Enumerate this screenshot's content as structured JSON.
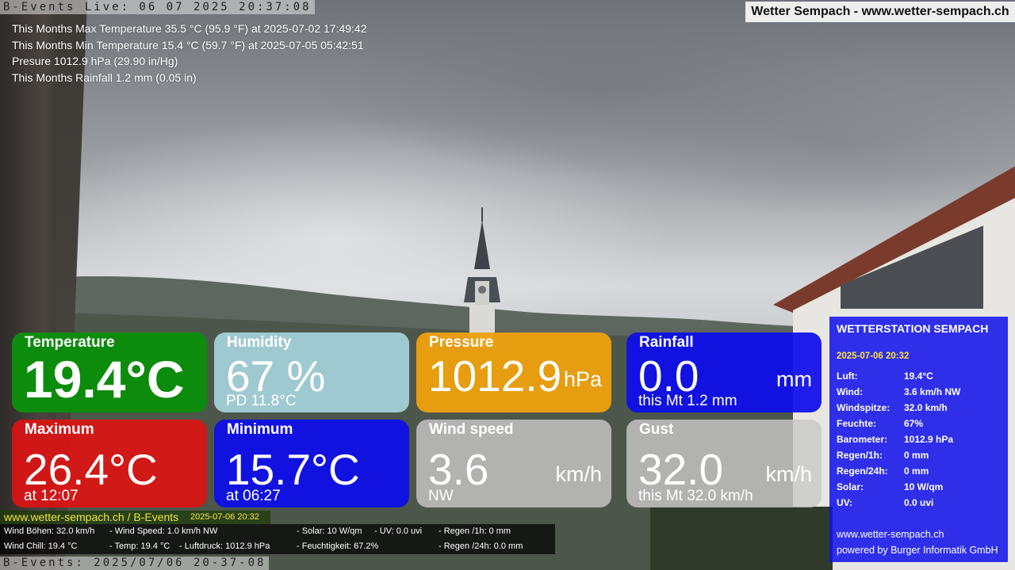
{
  "top_ticker": "B-Events Live: 06 07 2025 20:37:08",
  "site_badge": "Wetter Sempach - www.wetter-sempach.ch",
  "stats": [
    "This Months Max Temperature 35.5 °C (95.9 °F) at 2025-07-02 17:49:42",
    "This Months Min Temperature 15.4 °C (59.7 °F) at 2025-07-05 05:42:51",
    "Presure 1012.9 hPa (29.90 in/Hg)",
    "This Months Rainfall 1.2 mm (0.05 in)"
  ],
  "tiles": {
    "temperature": {
      "label": "Temperature",
      "value": "19.4°C"
    },
    "humidity": {
      "label": "Humidity",
      "value": "67 %",
      "sub": "PD 11.8°C"
    },
    "pressure": {
      "label": "Pressure",
      "value": "1012.9",
      "unit": "hPa"
    },
    "rainfall": {
      "label": "Rainfall",
      "value": "0.0",
      "unit": "mm",
      "sub": "this Mt 1.2 mm"
    },
    "maximum": {
      "label": "Maximum",
      "value": "26.4°C",
      "sub": "at 12:07"
    },
    "minimum": {
      "label": "Minimum",
      "value": "15.7°C",
      "sub": "at 06:27"
    },
    "wind_speed": {
      "label": "Wind speed",
      "value": "3.6",
      "unit": "km/h",
      "sub": "NW"
    },
    "gust": {
      "label": "Gust",
      "value": "32.0",
      "unit": "km/h",
      "sub": "this Mt 32.0 km/h"
    }
  },
  "station": {
    "title": "WETTERSTATION SEMPACH",
    "date": "2025-07-06 20:32",
    "rows": [
      {
        "key": "Luft:",
        "value": "19.4°C"
      },
      {
        "key": "Wind:",
        "value": "3.6 km/h  NW"
      },
      {
        "key": "Windspitze:",
        "value": "32.0 km/h"
      },
      {
        "key": "Feuchte:",
        "value": "67%"
      },
      {
        "key": "Barometer:",
        "value": "1012.9 hPa"
      },
      {
        "key": "Regen/1h:",
        "value": "0 mm"
      },
      {
        "key": "Regen/24h:",
        "value": "0 mm"
      },
      {
        "key": "Solar:",
        "value": "10 W/qm"
      },
      {
        "key": "UV:",
        "value": "0.0 uvi"
      }
    ],
    "footer_site": "www.wetter-sempach.ch",
    "footer_credit": "powered by Burger Informatik GmbH"
  },
  "low_bar": {
    "site": "www.wetter-sempach.ch / B-Events",
    "date": "2025-07-06 20:32"
  },
  "bottom_info": {
    "row1": [
      "Wind Böhen: 32.0 km/h",
      "- Wind Speed: 1.0 km/h NW",
      "- Solar: 10 W/qm",
      "- UV: 0.0 uvi",
      "- Regen /1h:   0 mm"
    ],
    "row2": [
      "Wind Chill: 19.4 °C",
      "- Temp: 19.4 °C",
      "- Luftdruck: 1012.9 hPa",
      "- Feuchtigkeit: 67.2%",
      "- Regen /24h: 0.0 mm"
    ]
  },
  "bottom_ticker": "B-Events: 2025/07/06 20-37-08",
  "colors": {
    "temperature": "#0d8b0d",
    "humidity": "#a6d2dc",
    "pressure": "#eca00e",
    "rainfall": "#0c0ceb",
    "maximum": "#dc1414",
    "minimum": "#0c0ceb",
    "wind_speed": "#c8c8c8",
    "gust": "#c8c8c8",
    "station_panel": "#1010eb",
    "date_accent": "#ffe23a"
  }
}
